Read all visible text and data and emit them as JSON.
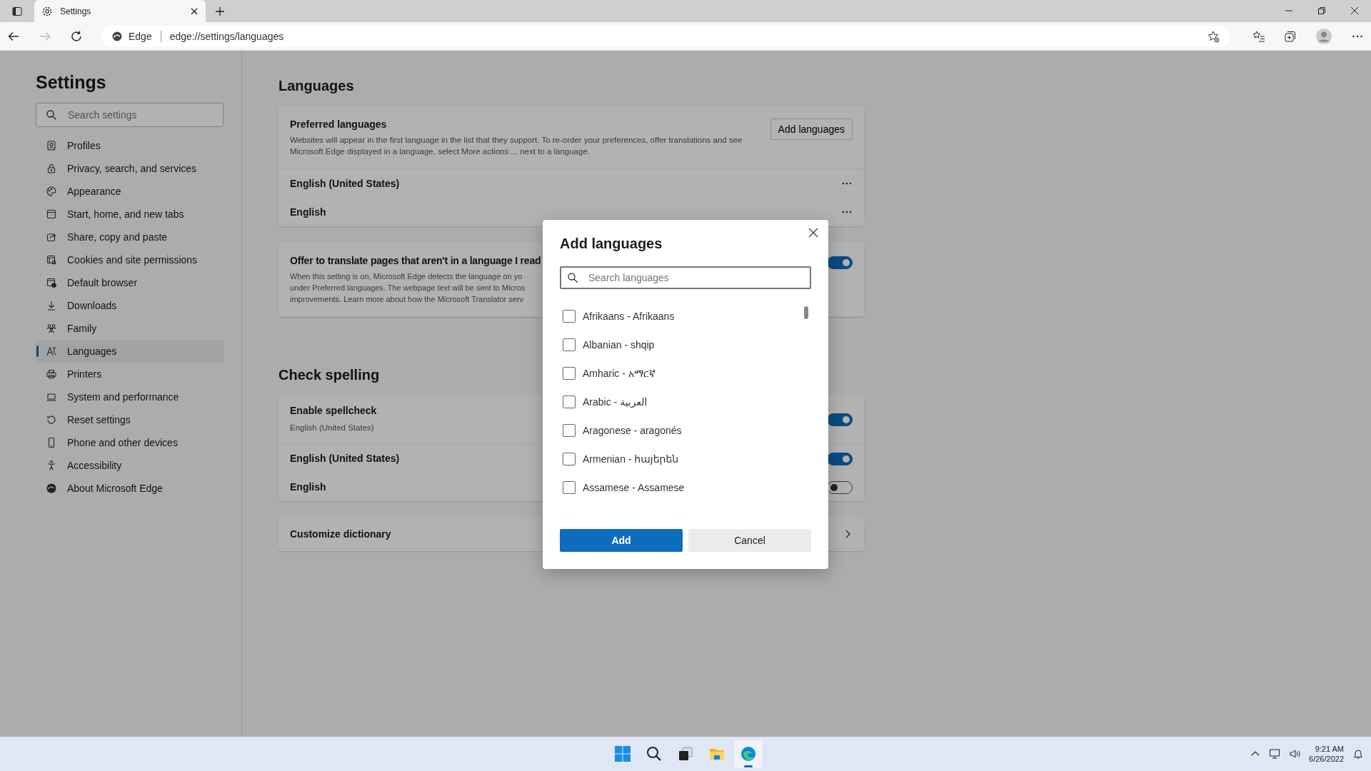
{
  "browser": {
    "tab": {
      "title": "Settings",
      "selected": true
    },
    "address": {
      "site_label": "Edge",
      "url": "edge://settings/languages"
    }
  },
  "sidebar": {
    "title": "Settings",
    "search": {
      "placeholder": "Search settings"
    },
    "items": [
      {
        "label": "Profiles",
        "selected": false
      },
      {
        "label": "Privacy, search, and services",
        "selected": false
      },
      {
        "label": "Appearance",
        "selected": false
      },
      {
        "label": "Start, home, and new tabs",
        "selected": false
      },
      {
        "label": "Share, copy and paste",
        "selected": false
      },
      {
        "label": "Cookies and site permissions",
        "selected": false
      },
      {
        "label": "Default browser",
        "selected": false
      },
      {
        "label": "Downloads",
        "selected": false
      },
      {
        "label": "Family",
        "selected": false
      },
      {
        "label": "Languages",
        "selected": true
      },
      {
        "label": "Printers",
        "selected": false
      },
      {
        "label": "System and performance",
        "selected": false
      },
      {
        "label": "Reset settings",
        "selected": false
      },
      {
        "label": "Phone and other devices",
        "selected": false
      },
      {
        "label": "Accessibility",
        "selected": false
      },
      {
        "label": "About Microsoft Edge",
        "selected": false
      }
    ]
  },
  "main": {
    "title": "Languages",
    "preferred": {
      "title": "Preferred languages",
      "description": "Websites will appear in the first language in the list that they support. To re-order your preferences, offer translations and see Microsoft Edge displayed in a language, select More actions ... next to a language.",
      "button": "Add languages",
      "languages": [
        "English (United States)",
        "English"
      ]
    },
    "translate": {
      "title": "Offer to translate pages that aren't in a language I read",
      "description": "When this setting is on, Microsoft Edge detects the language on yo\nunder Preferred languages. The webpage text will be sent to Micros\nimprovements. Learn more about how the Microsoft Translator serv",
      "on": true
    },
    "spelling_title": "Check spelling",
    "spelling": [
      {
        "title": "Enable spellcheck",
        "subtitle": "English (United States)",
        "on": true
      },
      {
        "title": "English (United States)",
        "on": true
      },
      {
        "title": "English",
        "on": false
      }
    ],
    "dictionary": {
      "title": "Customize dictionary"
    }
  },
  "dialog": {
    "title": "Add languages",
    "search": {
      "placeholder": "Search languages"
    },
    "languages": [
      {
        "label": "Afrikaans - Afrikaans",
        "checked": false
      },
      {
        "label": "Albanian - shqip",
        "checked": false
      },
      {
        "label": "Amharic - አማርኛ",
        "checked": false
      },
      {
        "label": "Arabic - العربية",
        "checked": false
      },
      {
        "label": "Aragonese - aragonés",
        "checked": false
      },
      {
        "label": "Armenian - հայերեն",
        "checked": false
      },
      {
        "label": "Assamese - Assamese",
        "checked": false
      }
    ],
    "add_button": "Add",
    "cancel_button": "Cancel"
  },
  "taskbar": {
    "apps": [
      {
        "active": false
      },
      {
        "active": false
      },
      {
        "active": false
      },
      {
        "active": false
      },
      {
        "active": true
      }
    ],
    "time": "9:21 AM",
    "date": "6/26/2022"
  }
}
